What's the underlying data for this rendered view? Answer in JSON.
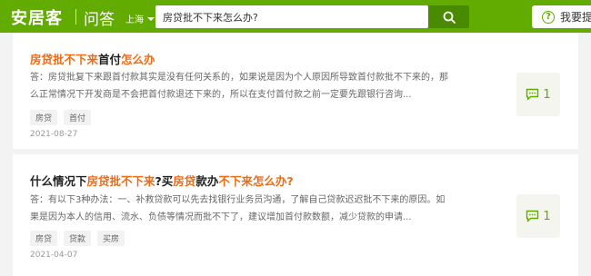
{
  "header": {
    "logo": "安居客",
    "section": "问答",
    "city": "上海",
    "search_value": "房贷批不下来怎么办?",
    "ask_button": "我要提问",
    "colors": {
      "brand": "#62ab00",
      "search_button": "#4a8a00",
      "highlight": "#f06a12"
    }
  },
  "questions": [
    {
      "title": [
        {
          "text": "房贷批不下来",
          "hl": true
        },
        {
          "text": "首付",
          "hl": false
        },
        {
          "text": "怎么办",
          "hl": true
        }
      ],
      "answer": "答：房贷批复下来跟首付款其实是没有任何关系的，如果说是因为个人原因所导致首付款批不下来的，那么正常情况下开发商是不会把首付款退还下来的，所以在支付首付款之前一定要先跟银行咨询...",
      "tags": [
        "房贷",
        "首付"
      ],
      "date": "2021-08-27",
      "answer_count": "1"
    },
    {
      "title": [
        {
          "text": "什么情况下",
          "hl": false
        },
        {
          "text": "房贷批不下来",
          "hl": true
        },
        {
          "text": "?买",
          "hl": false
        },
        {
          "text": "房贷",
          "hl": true
        },
        {
          "text": "款办",
          "hl": false
        },
        {
          "text": "不下来怎么办?",
          "hl": true
        }
      ],
      "answer": "答：有以下3种办法：一、补救贷款可以先去找银行业务员沟通，了解自己贷款迟迟批不下来的原因。如果是因为本人的信用、流水、负债等情况而批不下了，建议增加首付款数额，减少贷款的申请...",
      "tags": [
        "房贷",
        "贷款",
        "买房"
      ],
      "date": "2021-04-07",
      "answer_count": "1"
    }
  ]
}
